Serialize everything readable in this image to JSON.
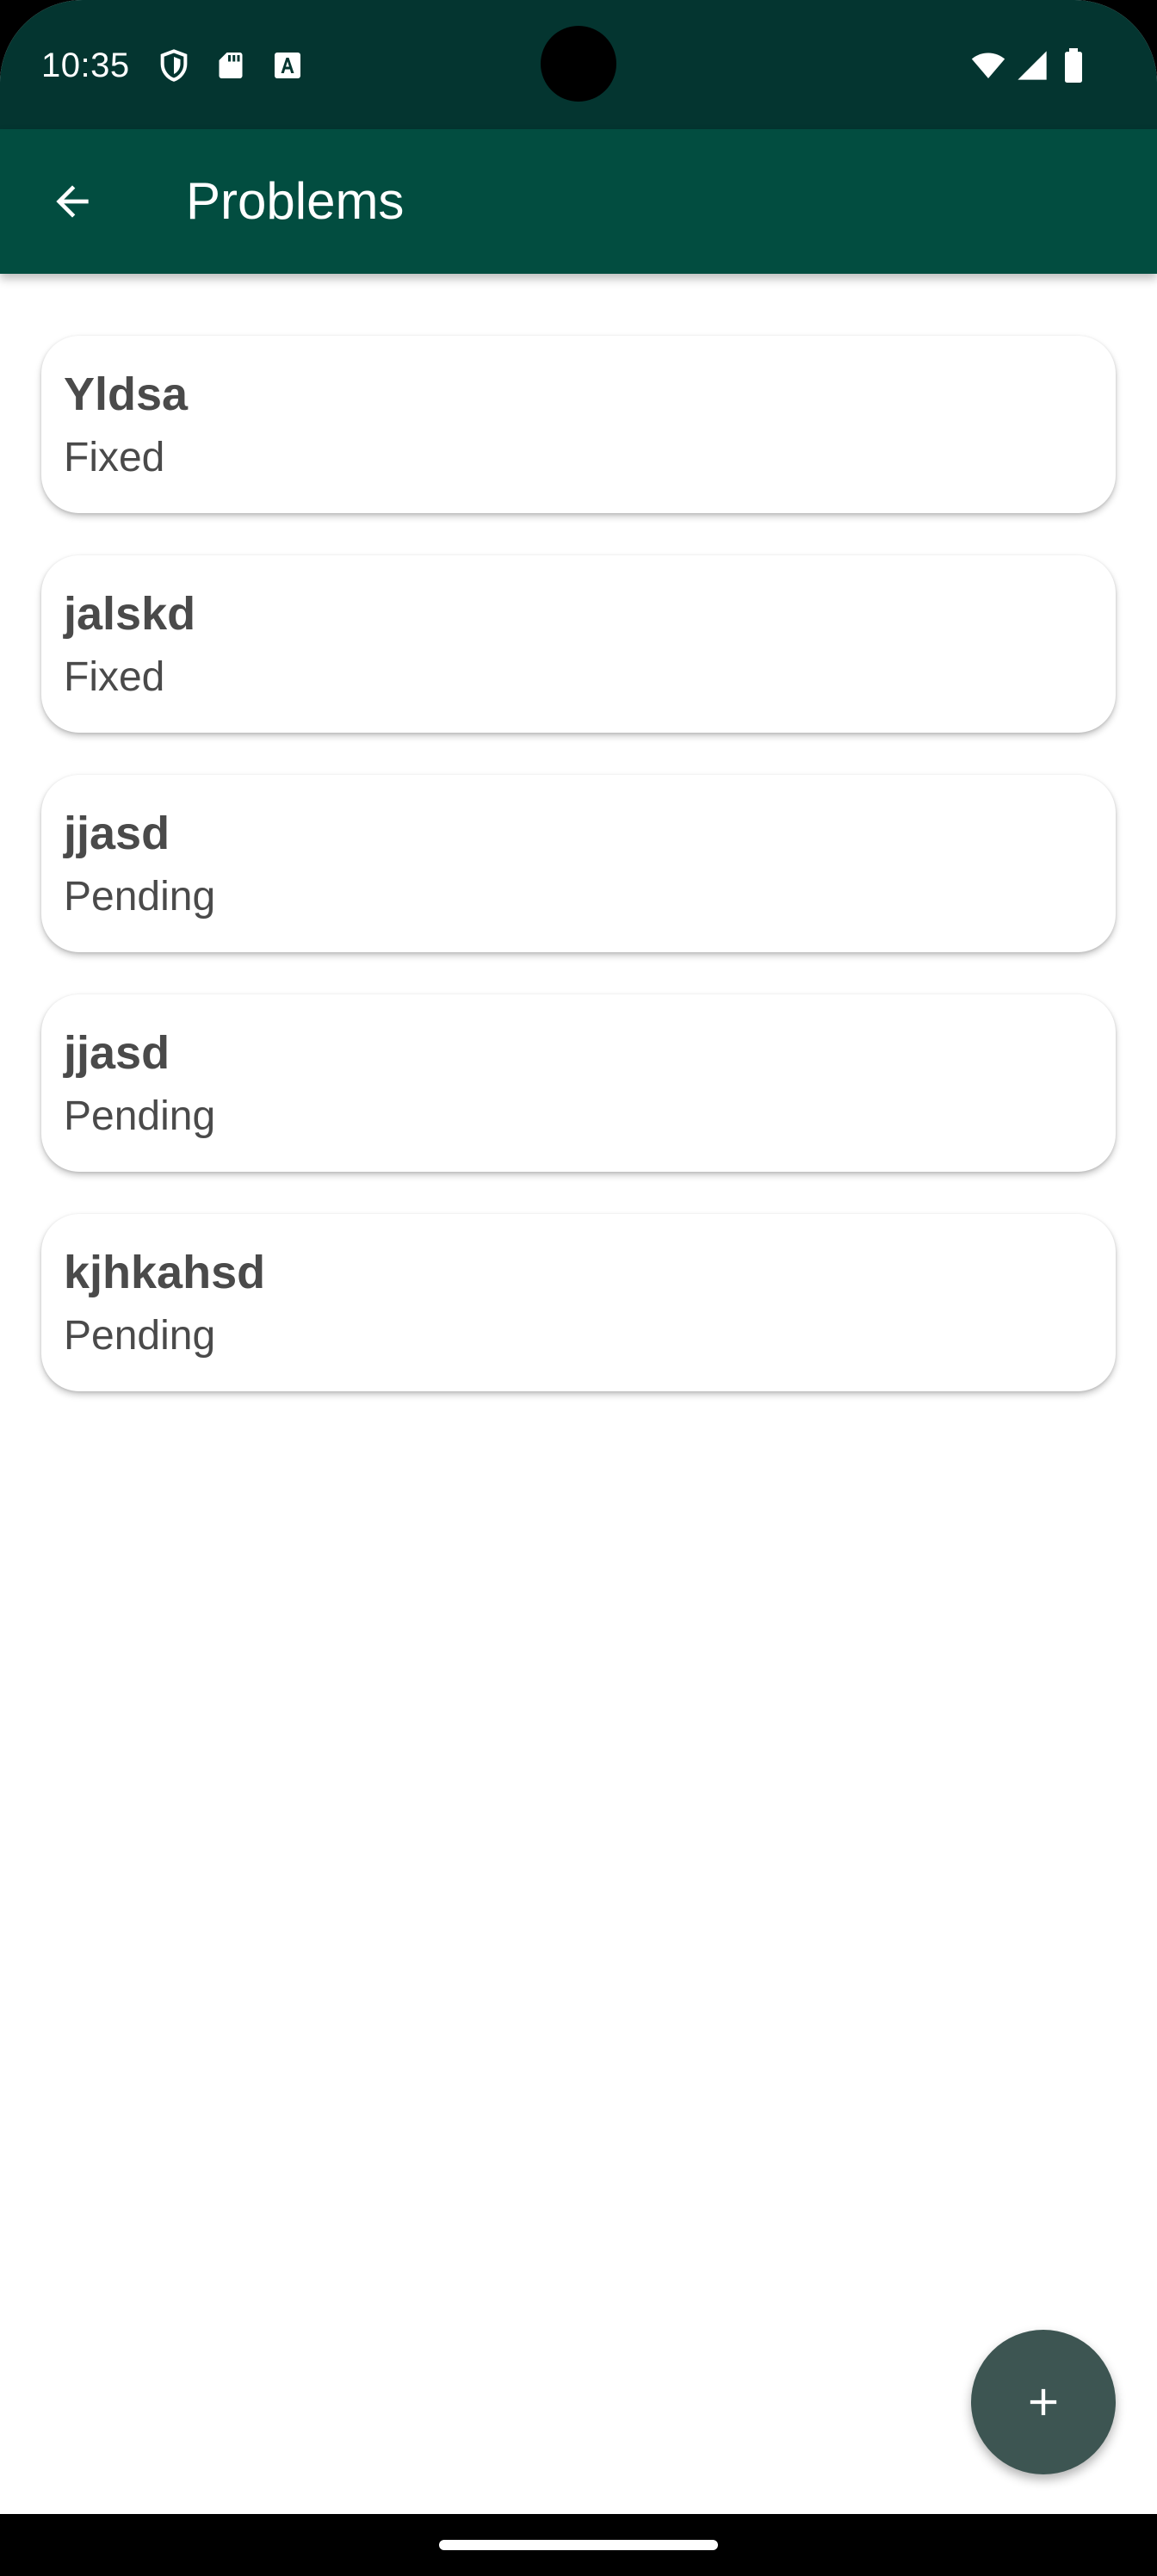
{
  "status_bar": {
    "time": "10:35",
    "left_icons": [
      "shield-icon",
      "sd-card-icon",
      "text-a-icon"
    ],
    "right_icons": [
      "wifi-icon",
      "signal-icon",
      "battery-icon"
    ]
  },
  "app_bar": {
    "title": "Problems",
    "back_icon": "arrow-back-icon",
    "color": "#024d40"
  },
  "problems": [
    {
      "title": "Yldsa",
      "status": "Fixed"
    },
    {
      "title": "jalskd",
      "status": "Fixed"
    },
    {
      "title": "jjasd",
      "status": "Pending"
    },
    {
      "title": "jjasd",
      "status": "Pending"
    },
    {
      "title": "kjhkahsd",
      "status": "Pending"
    }
  ],
  "fab": {
    "icon": "plus-icon",
    "color": "#3d5552"
  }
}
